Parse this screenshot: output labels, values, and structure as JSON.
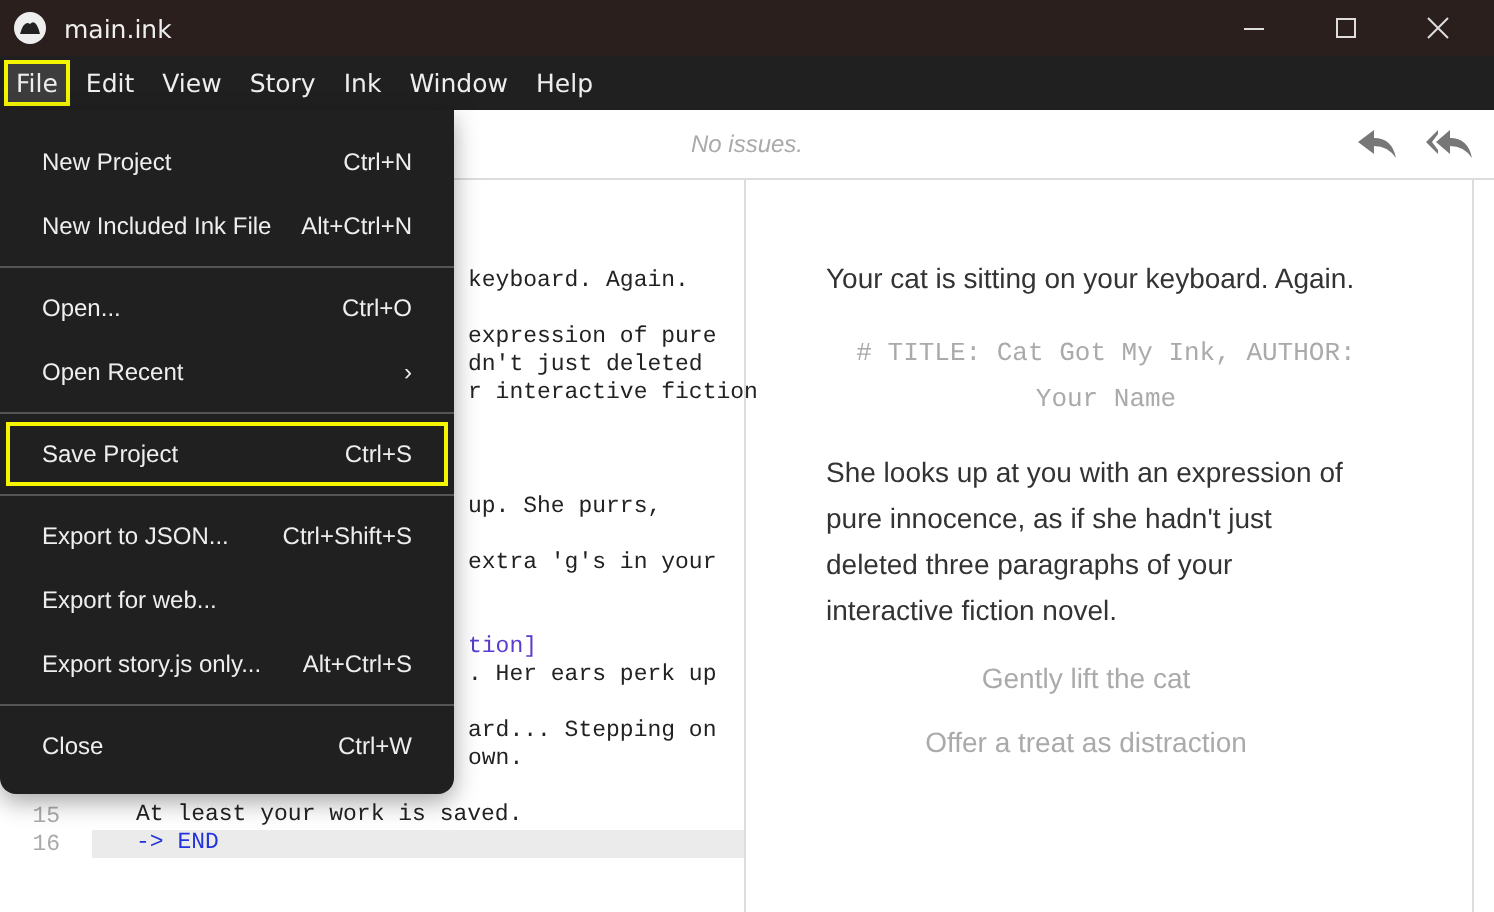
{
  "window": {
    "title": "main.ink"
  },
  "menubar": [
    {
      "label": "File",
      "selected": true
    },
    {
      "label": "Edit",
      "selected": false
    },
    {
      "label": "View",
      "selected": false
    },
    {
      "label": "Story",
      "selected": false
    },
    {
      "label": "Ink",
      "selected": false
    },
    {
      "label": "Window",
      "selected": false
    },
    {
      "label": "Help",
      "selected": false
    }
  ],
  "file_menu": {
    "groups": [
      [
        {
          "label": "New Project",
          "shortcut": "Ctrl+N",
          "highlighted": false
        },
        {
          "label": "New Included Ink File",
          "shortcut": "Alt+Ctrl+N",
          "highlighted": false
        }
      ],
      [
        {
          "label": "Open...",
          "shortcut": "Ctrl+O",
          "highlighted": false
        },
        {
          "label": "Open Recent",
          "submenu": "›",
          "highlighted": false
        }
      ],
      [
        {
          "label": "Save Project",
          "shortcut": "Ctrl+S",
          "highlighted": true
        }
      ],
      [
        {
          "label": "Export to JSON...",
          "shortcut": "Ctrl+Shift+S",
          "highlighted": false
        },
        {
          "label": "Export for web...",
          "highlighted": false
        },
        {
          "label": "Export story.js only...",
          "shortcut": "Alt+Ctrl+S",
          "highlighted": false
        }
      ],
      [
        {
          "label": "Close",
          "shortcut": "Ctrl+W",
          "highlighted": false
        }
      ]
    ]
  },
  "toolbar": {
    "status": "No issues."
  },
  "editor": {
    "hidden_blocks": [
      [
        {
          "text": "keyboard. Again.",
          "kind": "text"
        }
      ],
      [
        {
          "text": "expression of pure",
          "kind": "text"
        },
        {
          "text": "dn't just deleted",
          "kind": "text"
        },
        {
          "text": "r interactive fiction",
          "kind": "text"
        }
      ],
      [
        {
          "text": "up. She purrs,",
          "kind": "text"
        }
      ],
      [
        {
          "text": "extra 'g's in your",
          "kind": "text"
        }
      ],
      [
        {
          "text": "tion]",
          "kind": "choice"
        },
        {
          "text": ". Her ears perk up",
          "kind": "text"
        }
      ],
      [
        {
          "text": "ard... Stepping on",
          "kind": "text"
        },
        {
          "text": "own.",
          "kind": "text"
        }
      ]
    ],
    "lines": [
      {
        "number": "15",
        "text": "At least your work is saved.",
        "kind": "text",
        "current": false
      },
      {
        "number": "16",
        "text": "-> END",
        "kind": "divert",
        "current": true
      }
    ]
  },
  "preview": {
    "items": [
      {
        "kind": "text",
        "text": "Your cat is sitting on your keyboard. Again."
      },
      {
        "kind": "tag",
        "text": "# TITLE: Cat Got My Ink, AUTHOR: Your Name"
      },
      {
        "kind": "text",
        "text": "She looks up at you with an expression of pure innocence, as if she hadn't just deleted three paragraphs of your interactive fiction novel."
      },
      {
        "kind": "choice",
        "text": "Gently lift the cat"
      },
      {
        "kind": "choice",
        "text": "Offer a treat as distraction"
      }
    ]
  }
}
